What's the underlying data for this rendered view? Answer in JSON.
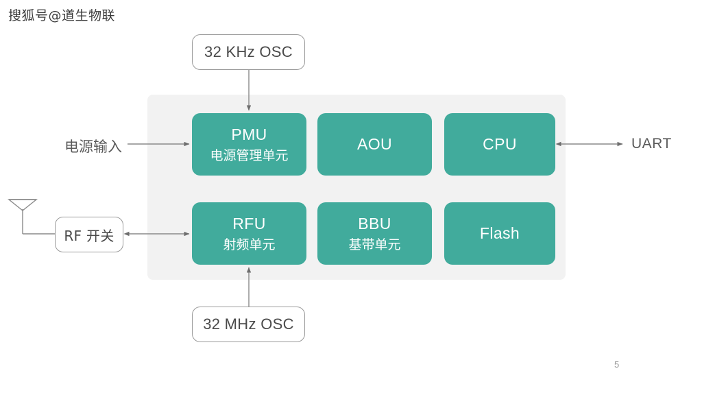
{
  "watermark": {
    "text": "搜狐号@道生物联"
  },
  "diagram": {
    "title_blocks": [
      {
        "id": "pmu",
        "title": "PMU",
        "subtitle": "电源管理单元"
      },
      {
        "id": "aou",
        "title": "AOU",
        "subtitle": ""
      },
      {
        "id": "cpu",
        "title": "CPU",
        "subtitle": ""
      },
      {
        "id": "rfu",
        "title": "RFU",
        "subtitle": "射频单元"
      },
      {
        "id": "bbu",
        "title": "BBU",
        "subtitle": "基带单元"
      },
      {
        "id": "flash",
        "title": "Flash",
        "subtitle": ""
      }
    ],
    "outline_boxes": {
      "osc_khz": "32 KHz OSC",
      "osc_mhz": "32 MHz OSC",
      "rf_switch": "RF 开关"
    },
    "labels": {
      "power_input": "电源输入",
      "uart": "UART"
    },
    "colors": {
      "block_fill": "#41ab9c",
      "block_text": "#ffffff",
      "panel_fill": "#f2f2f2",
      "outline_stroke": "#9a9a9a",
      "wire_stroke": "#7a7a7a",
      "label_text": "#5a5a5a"
    }
  },
  "footer": {
    "page_number": "5"
  }
}
